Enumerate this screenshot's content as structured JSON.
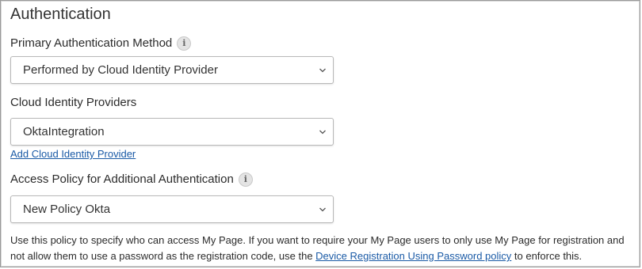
{
  "section": {
    "title": "Authentication"
  },
  "primary_method": {
    "label": "Primary Authentication Method",
    "info_icon": "info-icon",
    "selected": "Performed by Cloud Identity Provider"
  },
  "cloud_providers": {
    "label": "Cloud Identity Providers",
    "selected": "OktaIntegration",
    "add_link": "Add Cloud Identity Provider"
  },
  "access_policy": {
    "label": "Access Policy for Additional Authentication",
    "info_icon": "info-icon",
    "selected": "New Policy Okta"
  },
  "note": {
    "text_before": "Use this policy to specify who can access My Page. If you want to require your My Page users to only use My Page for registration and not allow them to use a password as the registration code, use the ",
    "link_text": "Device Registration Using Password policy",
    "text_after": " to enforce this."
  },
  "colors": {
    "link": "#1a5aa6",
    "border": "#b8b8b8",
    "text": "#2b2b2b"
  }
}
